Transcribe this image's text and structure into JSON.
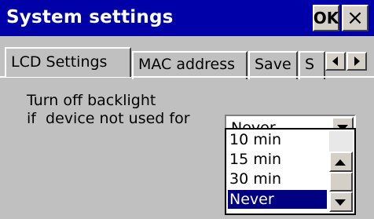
{
  "window": {
    "title": "System settings",
    "ok_label": "OK",
    "close_label": "×"
  },
  "tabs": [
    {
      "label": "LCD Settings",
      "active": true
    },
    {
      "label": "MAC address",
      "active": false
    },
    {
      "label": "Save",
      "active": false
    },
    {
      "label": "S",
      "active": false
    }
  ],
  "content": {
    "label_line1": "Turn off backlight",
    "label_line2": "if  device not used for",
    "combo_value": "Never",
    "options": [
      "10 min",
      "15 min",
      "30 min",
      "Never"
    ],
    "selected_option": "Never"
  },
  "colors": {
    "titlebar": "#0000a8",
    "selection": "#000080",
    "face": "#c0c0c0"
  }
}
